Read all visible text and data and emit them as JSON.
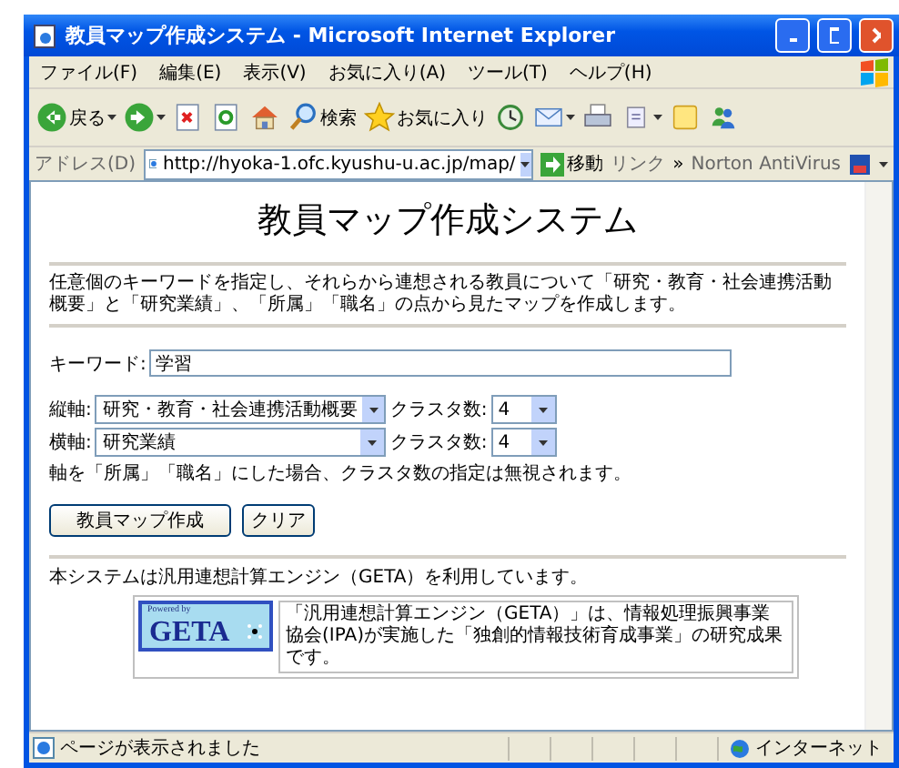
{
  "window": {
    "title": "教員マップ作成システム - Microsoft Internet Explorer"
  },
  "menu": [
    "ファイル(F)",
    "編集(E)",
    "表示(V)",
    "お気に入り(A)",
    "ツール(T)",
    "ヘルプ(H)"
  ],
  "toolbar": [
    {
      "kind": "back",
      "label": "戻る"
    },
    {
      "kind": "forward"
    },
    {
      "kind": "stop"
    },
    {
      "kind": "refresh"
    },
    {
      "kind": "home"
    },
    {
      "kind": "search",
      "label": "検索"
    },
    {
      "kind": "favorites",
      "label": "お気に入り"
    },
    {
      "kind": "history"
    },
    {
      "kind": "mail"
    },
    {
      "kind": "print"
    },
    {
      "kind": "edit"
    },
    {
      "kind": "note"
    },
    {
      "kind": "messenger"
    }
  ],
  "address_bar": {
    "label": "アドレス(D)",
    "url": "http://hyoka-1.ofc.kyushu-u.ac.jp/map/",
    "go": "移動",
    "links": "リンク",
    "more": "»",
    "toolbar": "Norton AntiVirus"
  },
  "page": {
    "heading": "教員マップ作成システム",
    "description": "任意個のキーワードを指定し、それらから連想される教員について「研究・教育・社会連携活動概要」と「研究業績」、「所属」「職名」の点から見たマップを作成します。",
    "keyword": {
      "label": "キーワード:",
      "value": "学習"
    },
    "axes": [
      {
        "label": "縦軸:",
        "value": "研究・教育・社会連携活動概要",
        "cluster_label": "クラスタ数:",
        "cluster_value": "4"
      },
      {
        "label": "横軸:",
        "value": "研究業績",
        "cluster_label": "クラスタ数:",
        "cluster_value": "4"
      }
    ],
    "note": "軸を「所属」「職名」にした場合、クラスタ数の指定は無視されます。",
    "buttons": [
      "教員マップ作成",
      "クリア"
    ],
    "footer": "本システムは汎用連想計算エンジン（GETA）を利用しています。",
    "geta": {
      "badge_top": "Powered by",
      "badge": "GETA",
      "text": "「汎用連想計算エンジン（GETA）」は、情報処理振興事業協会(IPA)が実施した「独創的情報技術育成事業」の研究成果です。"
    }
  },
  "status_bar": {
    "text": "ページが表示されました",
    "zone": "インターネット"
  }
}
